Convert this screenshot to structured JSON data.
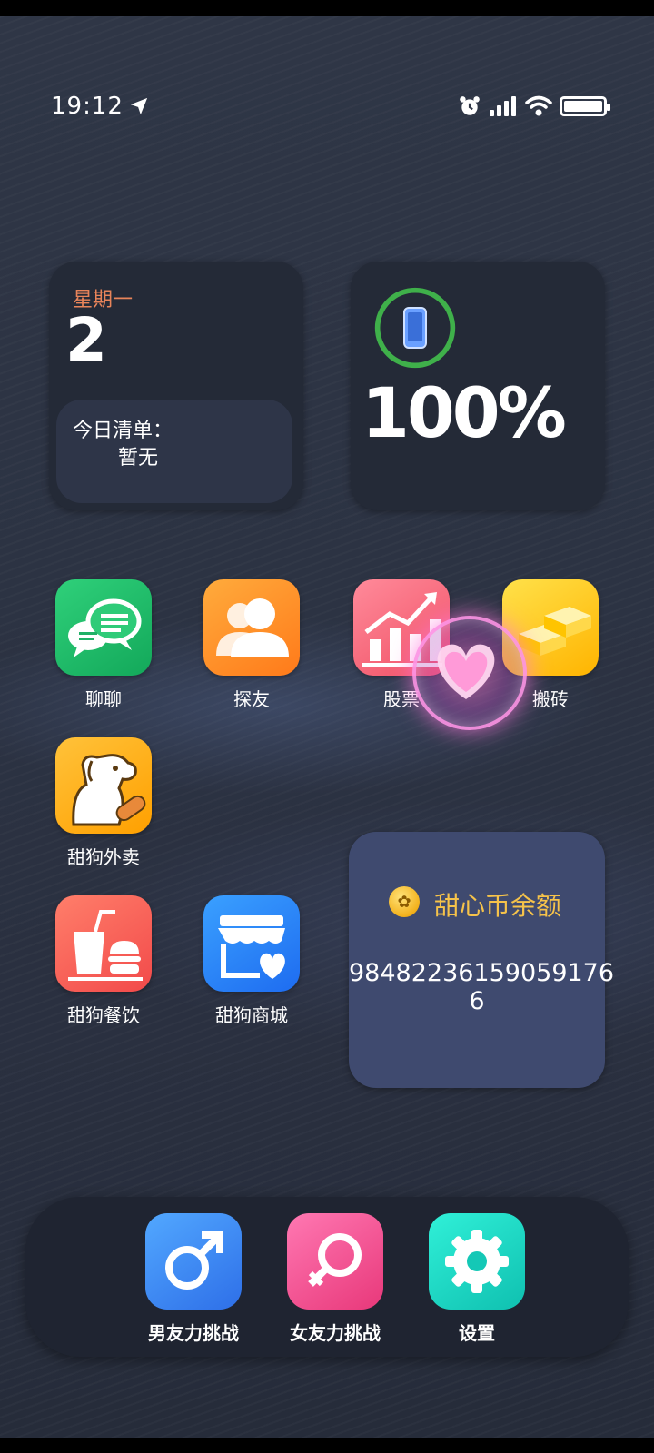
{
  "status_bar": {
    "time": "19:12",
    "icons": [
      "location-arrow-icon",
      "alarm-icon",
      "signal-icon",
      "wifi-icon",
      "battery-icon"
    ],
    "battery_level": 1.0
  },
  "calendar_widget": {
    "weekday": "星期一",
    "day": "2",
    "todo_title": "今日清单：",
    "todo_body": "暂无"
  },
  "battery_widget": {
    "percent_text": "100%",
    "level": 1.0,
    "ring_color": "#3fb04a",
    "icon": "phone-icon"
  },
  "apps": [
    {
      "label": "聊聊",
      "icon": "chat-bubbles-icon"
    },
    {
      "label": "探友",
      "icon": "people-icon"
    },
    {
      "label": "股票",
      "icon": "stock-chart-icon"
    },
    {
      "label": "搬砖",
      "icon": "gold-bars-icon"
    },
    {
      "label": "甜狗外卖",
      "icon": "dog-icon"
    },
    {
      "label": "甜狗餐饮",
      "icon": "drink-burger-icon"
    },
    {
      "label": "甜狗商城",
      "icon": "shop-heart-icon"
    }
  ],
  "coins_widget": {
    "title": "甜心币余额",
    "value": "98482236159059176​6",
    "icon": "paw-coin-icon",
    "title_color": "#f6c34a"
  },
  "floating_button": {
    "icon": "heart-icon"
  },
  "dock": [
    {
      "label": "男友力挑战",
      "icon": "male-symbol-icon"
    },
    {
      "label": "女友力挑战",
      "icon": "female-symbol-icon"
    },
    {
      "label": "设置",
      "icon": "gear-icon"
    }
  ]
}
